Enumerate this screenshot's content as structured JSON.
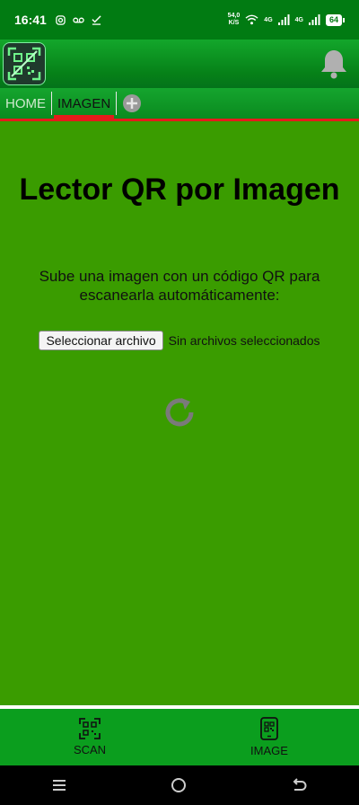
{
  "status_bar": {
    "time": "16:41",
    "net_speed_value": "54,0",
    "net_speed_unit": "K/S",
    "signal_1_label": "4G",
    "signal_2_label": "4G",
    "battery": "64",
    "icons": [
      "instagram-icon",
      "voicemail-icon",
      "check-icon",
      "wifi-icon",
      "signal-icon",
      "battery-icon"
    ]
  },
  "header": {
    "logo_icon": "qr-logo-icon",
    "bell_icon": "bell-icon"
  },
  "tabs": [
    {
      "label": "HOME",
      "active": false
    },
    {
      "label": "IMAGEN",
      "active": true
    }
  ],
  "add_tab_icon": "plus-circle-icon",
  "main": {
    "title": "Lector QR por Imagen",
    "subtitle": "Sube una imagen con un código QR para escanearla automáticamente:",
    "file_button": "Seleccionar archivo",
    "file_status": "Sin archivos seleccionados",
    "refresh_icon": "refresh-icon"
  },
  "bottom_nav": [
    {
      "label": "SCAN",
      "icon": "qr-scan-icon"
    },
    {
      "label": "IMAGE",
      "icon": "phone-qr-icon"
    }
  ],
  "system_nav": [
    "menu-icon",
    "home-icon",
    "back-icon"
  ],
  "colors": {
    "background": "#3a9c00",
    "header": "#068118",
    "accent_red": "#e51b1b",
    "bottom_nav": "#0b9e1e"
  }
}
